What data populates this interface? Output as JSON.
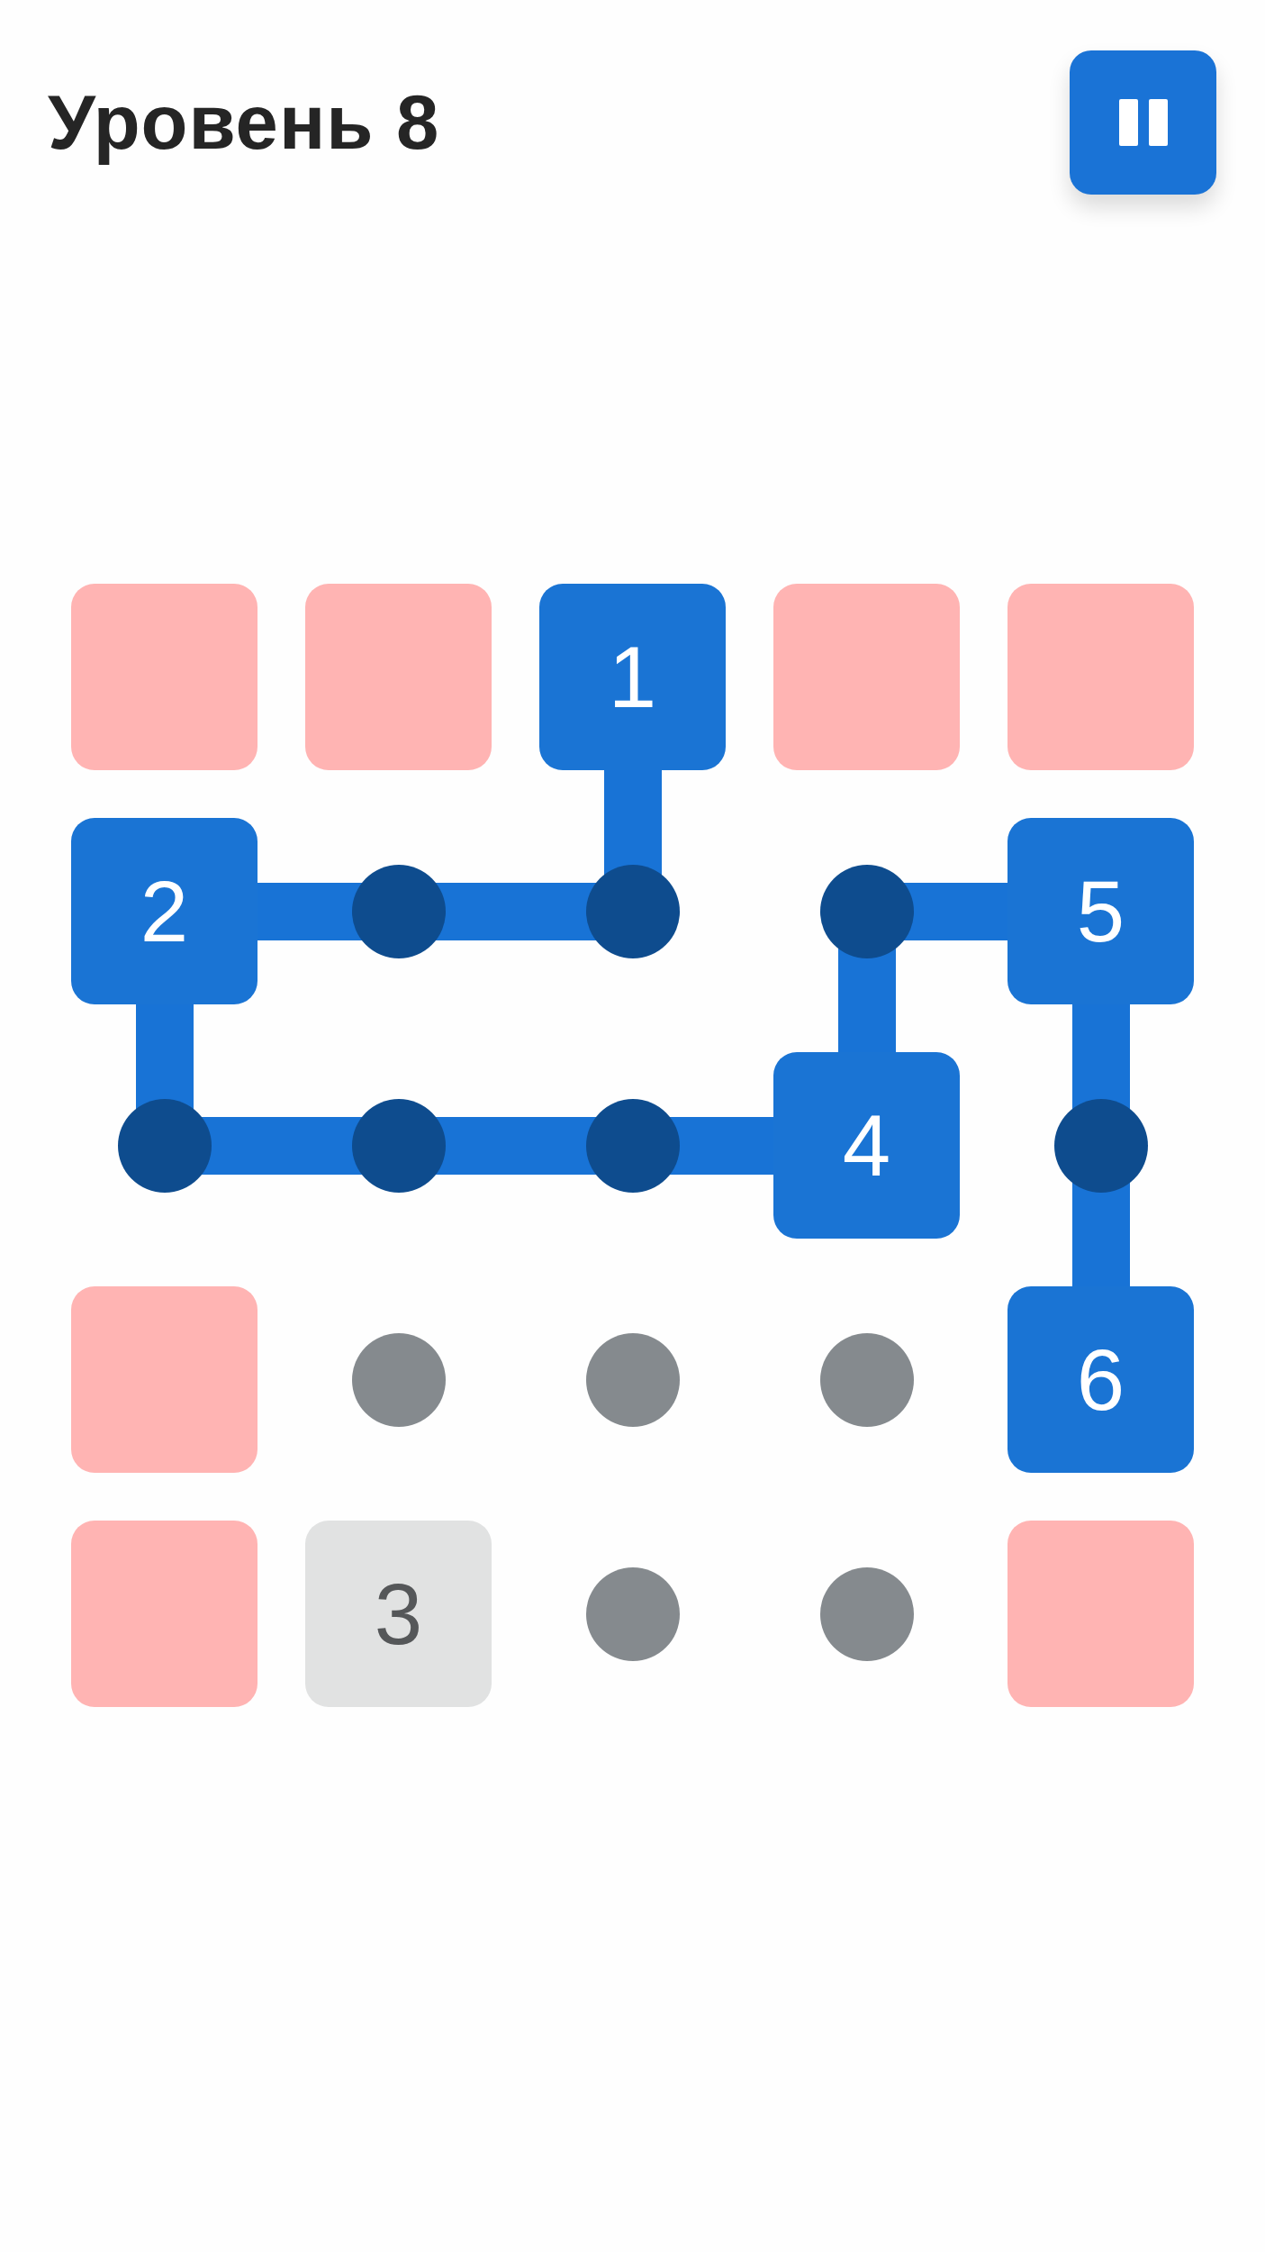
{
  "header": {
    "title": "Уровень 8"
  },
  "board": {
    "rows": [
      [
        {
          "kind": "blocked"
        },
        {
          "kind": "blocked"
        },
        {
          "kind": "number",
          "label": "1",
          "on_path": true,
          "link_down": true
        },
        {
          "kind": "blocked"
        },
        {
          "kind": "blocked"
        }
      ],
      [
        {
          "kind": "number",
          "label": "2",
          "on_path": true,
          "link_right": true,
          "link_down": true
        },
        {
          "kind": "dot",
          "on_path": true,
          "link_right": true
        },
        {
          "kind": "dot",
          "on_path": true
        },
        {
          "kind": "dot",
          "on_path": true,
          "link_right": true,
          "link_down": true
        },
        {
          "kind": "number",
          "label": "5",
          "on_path": true,
          "link_down": true
        }
      ],
      [
        {
          "kind": "dot",
          "on_path": true,
          "link_right": true
        },
        {
          "kind": "dot",
          "on_path": true,
          "link_right": true
        },
        {
          "kind": "dot",
          "on_path": true,
          "link_right": true
        },
        {
          "kind": "number",
          "label": "4",
          "on_path": true
        },
        {
          "kind": "dot",
          "on_path": true,
          "link_down": true
        }
      ],
      [
        {
          "kind": "blocked"
        },
        {
          "kind": "dot",
          "on_path": false
        },
        {
          "kind": "dot",
          "on_path": false
        },
        {
          "kind": "dot",
          "on_path": false
        },
        {
          "kind": "number",
          "label": "6",
          "on_path": true
        }
      ],
      [
        {
          "kind": "blocked"
        },
        {
          "kind": "number",
          "label": "3",
          "on_path": false
        },
        {
          "kind": "dot",
          "on_path": false
        },
        {
          "kind": "dot",
          "on_path": false
        },
        {
          "kind": "blocked"
        }
      ]
    ]
  }
}
